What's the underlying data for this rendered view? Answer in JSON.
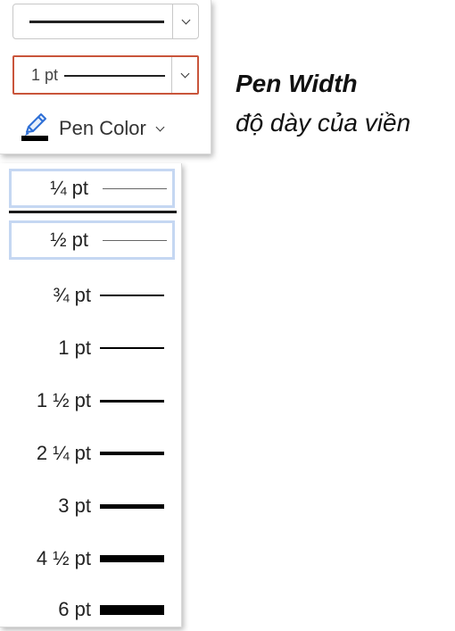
{
  "toolbar": {
    "width_value": "1 pt",
    "pen_color_label": "Pen Color"
  },
  "callout": {
    "title": "Pen Width",
    "subtitle": "độ dày của viền"
  },
  "width_options": [
    {
      "label": "¼ pt",
      "highlighted": true
    },
    {
      "label": "½ pt",
      "highlighted": true
    },
    {
      "label": "¾ pt",
      "highlighted": false
    },
    {
      "label": "1 pt",
      "highlighted": false
    },
    {
      "label": "1 ½ pt",
      "highlighted": false
    },
    {
      "label": "2 ¼ pt",
      "highlighted": false
    },
    {
      "label": "3 pt",
      "highlighted": false
    },
    {
      "label": "4 ½ pt",
      "highlighted": false
    },
    {
      "label": "6 pt",
      "highlighted": false
    }
  ],
  "colors": {
    "selected_border": "#c9553b",
    "hover_border": "#c5d7f2",
    "pen_swatch": "#000000",
    "pen_icon": "#2e6fd6"
  }
}
